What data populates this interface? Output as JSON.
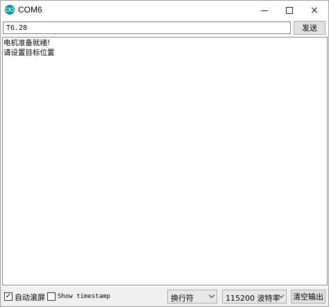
{
  "window": {
    "title": "COM6",
    "icon": "arduino-icon",
    "controls": {
      "minimize": "minimize-icon",
      "maximize": "maximize-icon",
      "close": "×"
    }
  },
  "input": {
    "value": "T6.28",
    "send_label": "发送"
  },
  "output": {
    "lines": [
      "电机准备就绪!",
      "请设置目标位置"
    ]
  },
  "footer": {
    "autoscroll_label": "自动滚屏",
    "autoscroll_checked": true,
    "autoscroll_mark": "✓",
    "timestamp_label": "Show timestamp",
    "timestamp_checked": false,
    "line_ending": "换行符",
    "baud_rate": "115200 波特率",
    "clear_label": "清空输出"
  }
}
